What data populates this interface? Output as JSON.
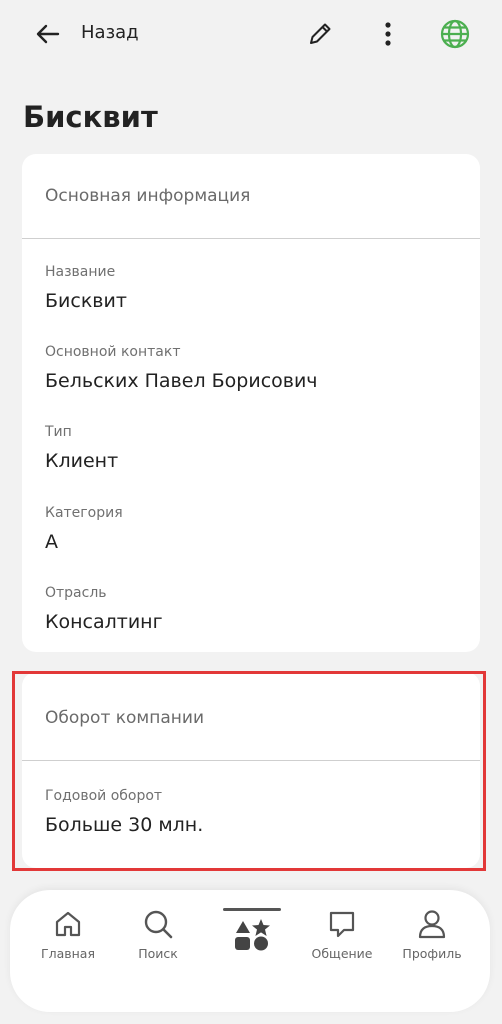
{
  "topbar": {
    "back_label": "Назад"
  },
  "page": {
    "title": "Бисквит"
  },
  "section_main": {
    "title": "Основная информация",
    "fields": [
      {
        "label": "Название",
        "value": "Бисквит"
      },
      {
        "label": "Основной контакт",
        "value": "Бельских Павел Борисович"
      },
      {
        "label": "Тип",
        "value": "Клиент"
      },
      {
        "label": "Категория",
        "value": "A"
      },
      {
        "label": "Отрасль",
        "value": "Консалтинг"
      }
    ]
  },
  "section_turnover": {
    "title": "Оборот компании",
    "fields": [
      {
        "label": "Годовой оборот",
        "value": "Больше 30 млн."
      }
    ]
  },
  "nav": {
    "items": [
      {
        "label": "Главная",
        "icon": "home-icon"
      },
      {
        "label": "Поиск",
        "icon": "search-icon"
      },
      {
        "label": "",
        "icon": "apps-icon"
      },
      {
        "label": "Общение",
        "icon": "chat-icon"
      },
      {
        "label": "Профиль",
        "icon": "profile-icon"
      }
    ]
  },
  "colors": {
    "globe": "#4caf50",
    "highlight": "#e23838"
  }
}
